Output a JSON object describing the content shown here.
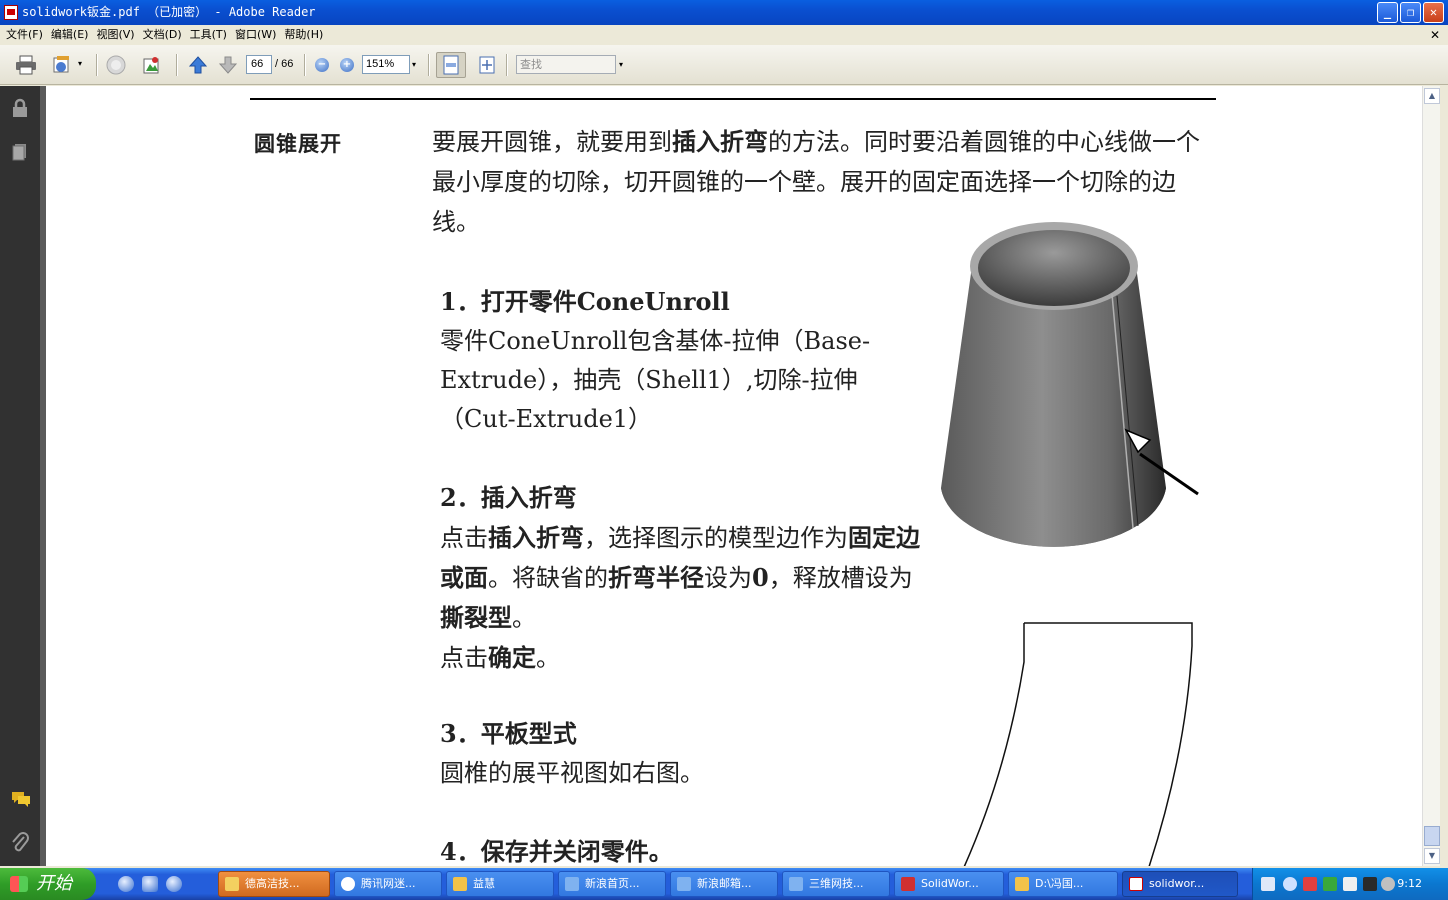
{
  "window": {
    "title": "solidwork钣金.pdf （已加密） - Adobe Reader",
    "min_glyph": "_",
    "max_glyph": "❐",
    "close_glyph": "✕",
    "doc_close_glyph": "✕"
  },
  "menu": {
    "file": "文件(F)",
    "edit": "编辑(E)",
    "view": "视图(V)",
    "document": "文档(D)",
    "tools": "工具(T)",
    "window": "窗口(W)",
    "help": "帮助(H)"
  },
  "toolbar": {
    "page_current": "66",
    "page_total": "/ 66",
    "zoom": "151%",
    "find_placeholder": "查找"
  },
  "document": {
    "side_heading": "圆锥展开",
    "intro_1": "要展开圆锥，就要用到",
    "intro_bold": "插入折弯",
    "intro_2": "的方法。同时要沿着圆锥的中心线做一个最小厚度的切除，切开圆锥的一个壁。展开的固定面选择一个切除的边线。",
    "step1_title": "1．打开零件ConeUnroll",
    "step1_text": "零件ConeUnroll包含基体-拉伸（Base-Extrude），抽壳（Shell1）,切除-拉伸（Cut-Extrude1）",
    "step2_title": "2．插入折弯",
    "step2_a": "点击",
    "step2_b": "插入折弯",
    "step2_c": "，选择图示的模型边作为",
    "step2_d": "固定边或面",
    "step2_e": "。将缺省的",
    "step2_f": "折弯半径",
    "step2_g": "设为",
    "step2_h": "0",
    "step2_i": "，释放槽设为",
    "step2_j": "撕裂型",
    "step2_k": "。",
    "step2_l": "点击",
    "step2_m": "确定",
    "step2_n": "。",
    "step3_title": "3．平板型式",
    "step3_text": "圆椎的展平视图如右图。",
    "step4_title": "4．保存并关闭零件。"
  },
  "taskbar": {
    "start": "开始",
    "tasks": [
      {
        "label": "德高洁技..."
      },
      {
        "label": "腾讯网迷..."
      },
      {
        "label": "益慧"
      },
      {
        "label": "新浪首页..."
      },
      {
        "label": "新浪邮箱..."
      },
      {
        "label": "三维网技..."
      },
      {
        "label": "SolidWor..."
      },
      {
        "label": "D:\\冯国..."
      },
      {
        "label": "solidwor..."
      }
    ],
    "clock": "9:12"
  }
}
